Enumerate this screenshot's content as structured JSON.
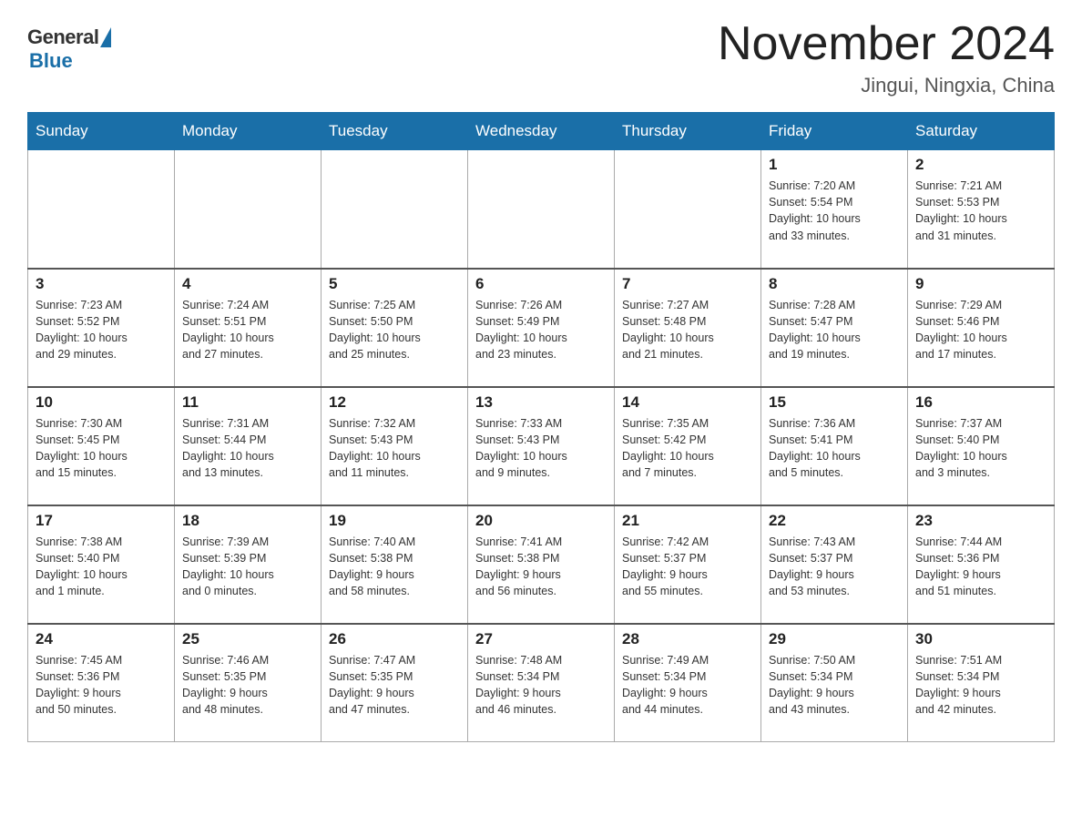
{
  "header": {
    "logo_general": "General",
    "logo_blue": "Blue",
    "title": "November 2024",
    "location": "Jingui, Ningxia, China"
  },
  "weekdays": [
    "Sunday",
    "Monday",
    "Tuesday",
    "Wednesday",
    "Thursday",
    "Friday",
    "Saturday"
  ],
  "weeks": [
    [
      {
        "day": "",
        "info": ""
      },
      {
        "day": "",
        "info": ""
      },
      {
        "day": "",
        "info": ""
      },
      {
        "day": "",
        "info": ""
      },
      {
        "day": "",
        "info": ""
      },
      {
        "day": "1",
        "info": "Sunrise: 7:20 AM\nSunset: 5:54 PM\nDaylight: 10 hours\nand 33 minutes."
      },
      {
        "day": "2",
        "info": "Sunrise: 7:21 AM\nSunset: 5:53 PM\nDaylight: 10 hours\nand 31 minutes."
      }
    ],
    [
      {
        "day": "3",
        "info": "Sunrise: 7:23 AM\nSunset: 5:52 PM\nDaylight: 10 hours\nand 29 minutes."
      },
      {
        "day": "4",
        "info": "Sunrise: 7:24 AM\nSunset: 5:51 PM\nDaylight: 10 hours\nand 27 minutes."
      },
      {
        "day": "5",
        "info": "Sunrise: 7:25 AM\nSunset: 5:50 PM\nDaylight: 10 hours\nand 25 minutes."
      },
      {
        "day": "6",
        "info": "Sunrise: 7:26 AM\nSunset: 5:49 PM\nDaylight: 10 hours\nand 23 minutes."
      },
      {
        "day": "7",
        "info": "Sunrise: 7:27 AM\nSunset: 5:48 PM\nDaylight: 10 hours\nand 21 minutes."
      },
      {
        "day": "8",
        "info": "Sunrise: 7:28 AM\nSunset: 5:47 PM\nDaylight: 10 hours\nand 19 minutes."
      },
      {
        "day": "9",
        "info": "Sunrise: 7:29 AM\nSunset: 5:46 PM\nDaylight: 10 hours\nand 17 minutes."
      }
    ],
    [
      {
        "day": "10",
        "info": "Sunrise: 7:30 AM\nSunset: 5:45 PM\nDaylight: 10 hours\nand 15 minutes."
      },
      {
        "day": "11",
        "info": "Sunrise: 7:31 AM\nSunset: 5:44 PM\nDaylight: 10 hours\nand 13 minutes."
      },
      {
        "day": "12",
        "info": "Sunrise: 7:32 AM\nSunset: 5:43 PM\nDaylight: 10 hours\nand 11 minutes."
      },
      {
        "day": "13",
        "info": "Sunrise: 7:33 AM\nSunset: 5:43 PM\nDaylight: 10 hours\nand 9 minutes."
      },
      {
        "day": "14",
        "info": "Sunrise: 7:35 AM\nSunset: 5:42 PM\nDaylight: 10 hours\nand 7 minutes."
      },
      {
        "day": "15",
        "info": "Sunrise: 7:36 AM\nSunset: 5:41 PM\nDaylight: 10 hours\nand 5 minutes."
      },
      {
        "day": "16",
        "info": "Sunrise: 7:37 AM\nSunset: 5:40 PM\nDaylight: 10 hours\nand 3 minutes."
      }
    ],
    [
      {
        "day": "17",
        "info": "Sunrise: 7:38 AM\nSunset: 5:40 PM\nDaylight: 10 hours\nand 1 minute."
      },
      {
        "day": "18",
        "info": "Sunrise: 7:39 AM\nSunset: 5:39 PM\nDaylight: 10 hours\nand 0 minutes."
      },
      {
        "day": "19",
        "info": "Sunrise: 7:40 AM\nSunset: 5:38 PM\nDaylight: 9 hours\nand 58 minutes."
      },
      {
        "day": "20",
        "info": "Sunrise: 7:41 AM\nSunset: 5:38 PM\nDaylight: 9 hours\nand 56 minutes."
      },
      {
        "day": "21",
        "info": "Sunrise: 7:42 AM\nSunset: 5:37 PM\nDaylight: 9 hours\nand 55 minutes."
      },
      {
        "day": "22",
        "info": "Sunrise: 7:43 AM\nSunset: 5:37 PM\nDaylight: 9 hours\nand 53 minutes."
      },
      {
        "day": "23",
        "info": "Sunrise: 7:44 AM\nSunset: 5:36 PM\nDaylight: 9 hours\nand 51 minutes."
      }
    ],
    [
      {
        "day": "24",
        "info": "Sunrise: 7:45 AM\nSunset: 5:36 PM\nDaylight: 9 hours\nand 50 minutes."
      },
      {
        "day": "25",
        "info": "Sunrise: 7:46 AM\nSunset: 5:35 PM\nDaylight: 9 hours\nand 48 minutes."
      },
      {
        "day": "26",
        "info": "Sunrise: 7:47 AM\nSunset: 5:35 PM\nDaylight: 9 hours\nand 47 minutes."
      },
      {
        "day": "27",
        "info": "Sunrise: 7:48 AM\nSunset: 5:34 PM\nDaylight: 9 hours\nand 46 minutes."
      },
      {
        "day": "28",
        "info": "Sunrise: 7:49 AM\nSunset: 5:34 PM\nDaylight: 9 hours\nand 44 minutes."
      },
      {
        "day": "29",
        "info": "Sunrise: 7:50 AM\nSunset: 5:34 PM\nDaylight: 9 hours\nand 43 minutes."
      },
      {
        "day": "30",
        "info": "Sunrise: 7:51 AM\nSunset: 5:34 PM\nDaylight: 9 hours\nand 42 minutes."
      }
    ]
  ]
}
